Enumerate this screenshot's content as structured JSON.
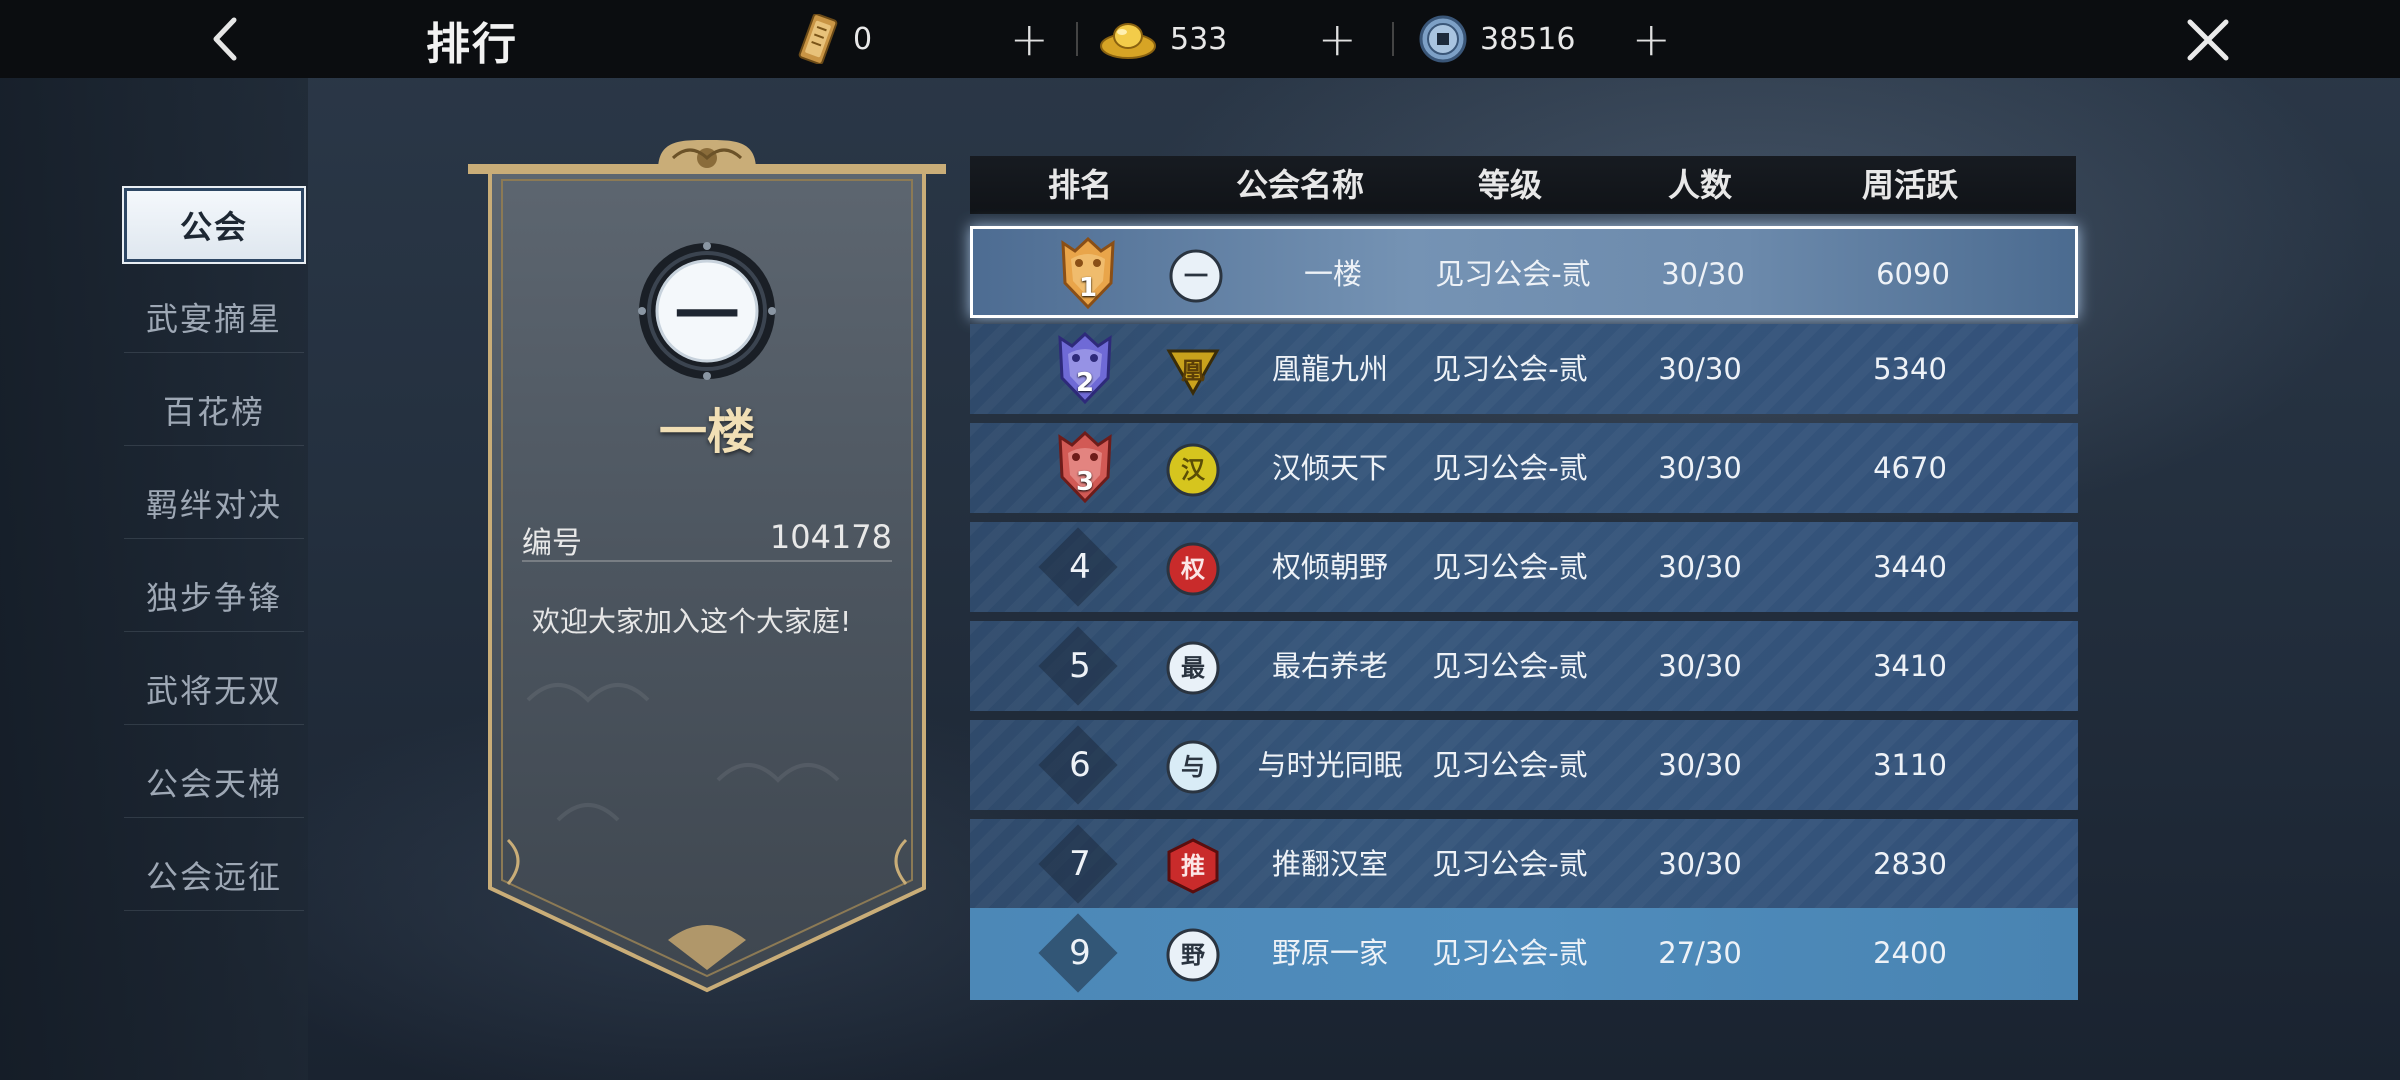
{
  "header": {
    "title": "排行",
    "resources": [
      {
        "icon": "token-card-icon",
        "value": "0"
      },
      {
        "icon": "gold-ingot-icon",
        "value": "533"
      },
      {
        "icon": "coin-icon",
        "value": "38516"
      }
    ]
  },
  "sidebar": {
    "items": [
      {
        "label": "公会",
        "active": true
      },
      {
        "label": "武宴摘星"
      },
      {
        "label": "百花榜"
      },
      {
        "label": "羁绊对决"
      },
      {
        "label": "独步争锋"
      },
      {
        "label": "武将无双"
      },
      {
        "label": "公会天梯"
      },
      {
        "label": "公会远征"
      }
    ]
  },
  "guild_detail": {
    "emblem_char": "一",
    "name": "一楼",
    "id_label": "编号",
    "id_value": "104178",
    "motto": "欢迎大家加入这个大家庭!"
  },
  "table": {
    "headers": {
      "rank": "排名",
      "name": "公会名称",
      "level": "等级",
      "members": "人数",
      "weekly": "周活跃"
    },
    "rows": [
      {
        "rank": "1",
        "badge": "一",
        "badge_color": "#e9f1f8",
        "badge_text_color": "#2a3440",
        "name": "一楼",
        "level": "见习公会-贰",
        "members": "30/30",
        "weekly": "6090"
      },
      {
        "rank": "2",
        "badge": "凰",
        "badge_color": "#c9a21c",
        "badge_text_color": "#5b3e07",
        "name": "凰龍九州",
        "level": "见习公会-贰",
        "members": "30/30",
        "weekly": "5340"
      },
      {
        "rank": "3",
        "badge": "汉",
        "badge_color": "#d6c51e",
        "badge_text_color": "#5b4e06",
        "name": "汉倾天下",
        "level": "见习公会-贰",
        "members": "30/30",
        "weekly": "4670"
      },
      {
        "rank": "4",
        "badge": "权",
        "badge_color": "#c92b2b",
        "badge_text_color": "#fbe6e6",
        "name": "权倾朝野",
        "level": "见习公会-贰",
        "members": "30/30",
        "weekly": "3440"
      },
      {
        "rank": "5",
        "badge": "最",
        "badge_color": "#e9f1f8",
        "badge_text_color": "#2a3440",
        "name": "最右养老",
        "level": "见习公会-贰",
        "members": "30/30",
        "weekly": "3410"
      },
      {
        "rank": "6",
        "badge": "与",
        "badge_color": "#d9ecf6",
        "badge_text_color": "#2a3440",
        "name": "与时光同眠",
        "level": "见习公会-贰",
        "members": "30/30",
        "weekly": "3110"
      },
      {
        "rank": "7",
        "badge": "推",
        "badge_color": "#c92b2b",
        "badge_text_color": "#fbe6e6",
        "name": "推翻汉室",
        "level": "见习公会-贰",
        "members": "30/30",
        "weekly": "2830"
      },
      {
        "rank": "9",
        "badge": "野",
        "badge_color": "#e9f1f8",
        "badge_text_color": "#2a3440",
        "name": "野原一家",
        "level": "见习公会-贰",
        "members": "27/30",
        "weekly": "2400"
      }
    ]
  },
  "colors": {
    "accent_gold": "#c9ad78",
    "row_blue": "#34527a",
    "own_row_blue": "#4f8cbc"
  }
}
